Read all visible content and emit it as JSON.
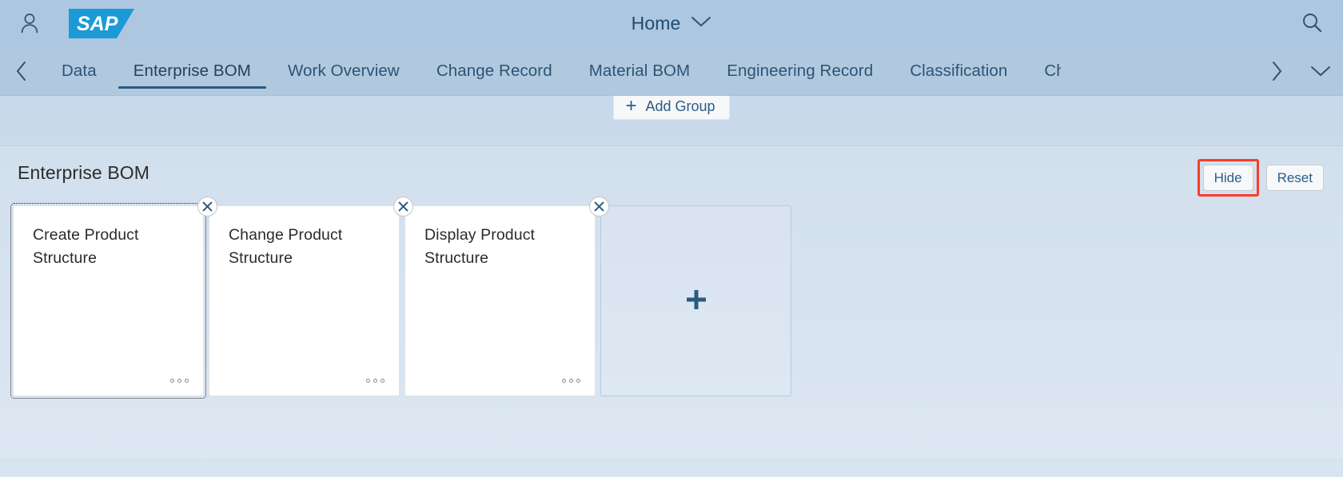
{
  "shell": {
    "user_icon": "user-avatar-icon",
    "logo_text": "SAP",
    "title": "Home",
    "title_chevron_icon": "chevron-down-icon",
    "search_icon": "search-icon"
  },
  "tabbar": {
    "prev_icon": "chevron-left-icon",
    "next_icon": "chevron-right-icon",
    "overflow_icon": "chevron-down-icon",
    "selected_index": 1,
    "tabs": [
      {
        "label": "Data"
      },
      {
        "label": "Enterprise BOM"
      },
      {
        "label": "Work Overview"
      },
      {
        "label": "Change Record"
      },
      {
        "label": "Material BOM"
      },
      {
        "label": "Engineering Record"
      },
      {
        "label": "Classification"
      },
      {
        "label": "Cha"
      }
    ]
  },
  "add_group": {
    "icon": "plus-icon",
    "label": "Add Group"
  },
  "section": {
    "title": "Enterprise BOM",
    "hide_label": "Hide",
    "reset_label": "Reset",
    "annotation_color": "#fa3c28"
  },
  "tiles": [
    {
      "title": "Create Product Structure",
      "close_icon": "close-icon",
      "more_icon": "more-dots-icon",
      "focused": true
    },
    {
      "title": "Change Product Structure",
      "close_icon": "close-icon",
      "more_icon": "more-dots-icon",
      "focused": false
    },
    {
      "title": "Display Product Structure",
      "close_icon": "close-icon",
      "more_icon": "more-dots-icon",
      "focused": false
    }
  ],
  "add_tile": {
    "icon": "plus-icon"
  },
  "colors": {
    "shell_bg": "#adc7e0",
    "tabbar_bg": "#b1c9de",
    "accent_blue": "#2c5a80",
    "sap_logo_blue": "#1b9ad6",
    "tile_bg": "#ffffff"
  }
}
